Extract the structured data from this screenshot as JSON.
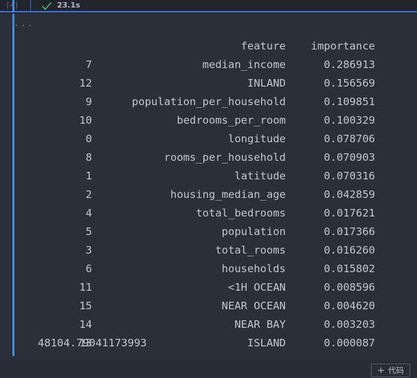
{
  "cell": {
    "execution_count_label": "[4]",
    "status_icon": "check-icon",
    "execution_time": "23.1s",
    "collapse_ellipsis": "..."
  },
  "colors": {
    "accent_blue": "#4a86e8",
    "header_rule_blue": "#3b74d8",
    "success_green": "#5cb85c",
    "cell_background": "#2b3038",
    "page_background": "#282c34",
    "header_background": "#21252b",
    "text_primary": "#c1c7d0",
    "text_muted": "#70767f"
  },
  "output": {
    "header": {
      "index": "",
      "feature": "feature",
      "importance": "importance"
    },
    "rows": [
      {
        "index": "7",
        "feature": "median_income",
        "importance": "0.286913"
      },
      {
        "index": "12",
        "feature": "INLAND",
        "importance": "0.156569"
      },
      {
        "index": "9",
        "feature": "population_per_household",
        "importance": "0.109851"
      },
      {
        "index": "10",
        "feature": "bedrooms_per_room",
        "importance": "0.100329"
      },
      {
        "index": "0",
        "feature": "longitude",
        "importance": "0.078706"
      },
      {
        "index": "8",
        "feature": "rooms_per_household",
        "importance": "0.070903"
      },
      {
        "index": "1",
        "feature": "latitude",
        "importance": "0.070316"
      },
      {
        "index": "2",
        "feature": "housing_median_age",
        "importance": "0.042859"
      },
      {
        "index": "4",
        "feature": "total_bedrooms",
        "importance": "0.017621"
      },
      {
        "index": "5",
        "feature": "population",
        "importance": "0.017366"
      },
      {
        "index": "3",
        "feature": "total_rooms",
        "importance": "0.016260"
      },
      {
        "index": "6",
        "feature": "households",
        "importance": "0.015802"
      },
      {
        "index": "11",
        "feature": "<1H OCEAN",
        "importance": "0.008596"
      },
      {
        "index": "15",
        "feature": "NEAR OCEAN",
        "importance": "0.004620"
      },
      {
        "index": "14",
        "feature": "NEAR BAY",
        "importance": "0.003203"
      },
      {
        "index": "13",
        "feature": "ISLAND",
        "importance": "0.000087"
      }
    ],
    "scalar_result": "48104.79041173993"
  },
  "toolbar": {
    "add_code_label": "代码",
    "add_code_plus": "+"
  }
}
